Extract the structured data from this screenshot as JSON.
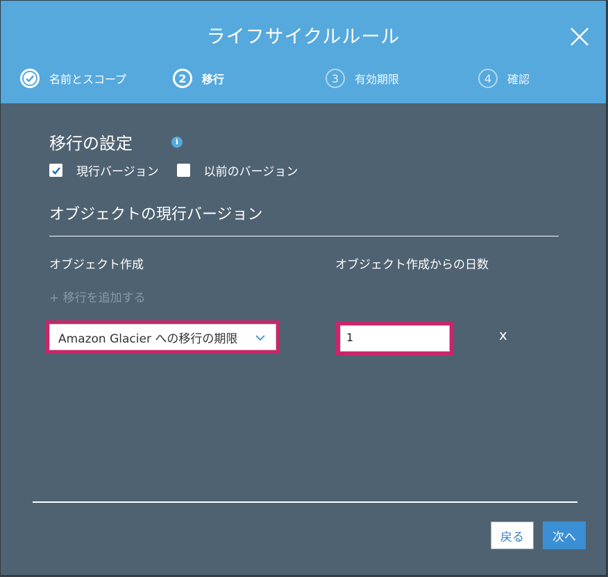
{
  "modal": {
    "title": "ライフサイクルルール"
  },
  "steps": [
    {
      "number": "",
      "label": "名前とスコープ",
      "state": "done"
    },
    {
      "number": "2",
      "label": "移行",
      "state": "current"
    },
    {
      "number": "3",
      "label": "有効期限",
      "state": "future"
    },
    {
      "number": "4",
      "label": "確認",
      "state": "future"
    }
  ],
  "transition": {
    "section_title": "移行の設定",
    "info_icon": "i",
    "current_version_label": "現行バージョン",
    "current_version_checked": true,
    "previous_version_label": "以前のバージョン",
    "previous_version_checked": false,
    "subsection_title": "オブジェクトの現行バージョン",
    "col_object_creation": "オブジェクト作成",
    "col_days_since_creation": "オブジェクト作成からの日数",
    "add_transition_label": "+ 移行を追加する",
    "rule_select_value": "Amazon Glacier への移行の期限",
    "days_value": "1",
    "remove_label": "x"
  },
  "footer": {
    "back_label": "戻る",
    "next_label": "次へ"
  },
  "colors": {
    "header_bg": "#56a9dd",
    "body_bg": "#4f6271",
    "highlight": "#c8266a",
    "primary_button": "#3b8fd4"
  }
}
